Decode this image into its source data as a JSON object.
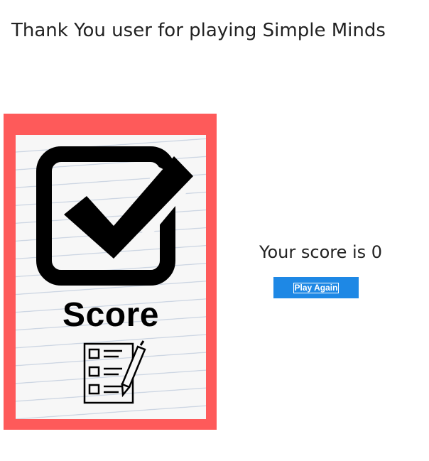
{
  "header": {
    "title": "Thank You user for playing Simple Minds"
  },
  "score_image": {
    "word": "Score",
    "background_color": "#fe5a5a",
    "icons": [
      "checkbox-checked-icon",
      "checklist-pencil-icon"
    ]
  },
  "result": {
    "score_text": "Your score is 0",
    "play_again_label": "Play Again",
    "button_color": "#1e88e5"
  }
}
